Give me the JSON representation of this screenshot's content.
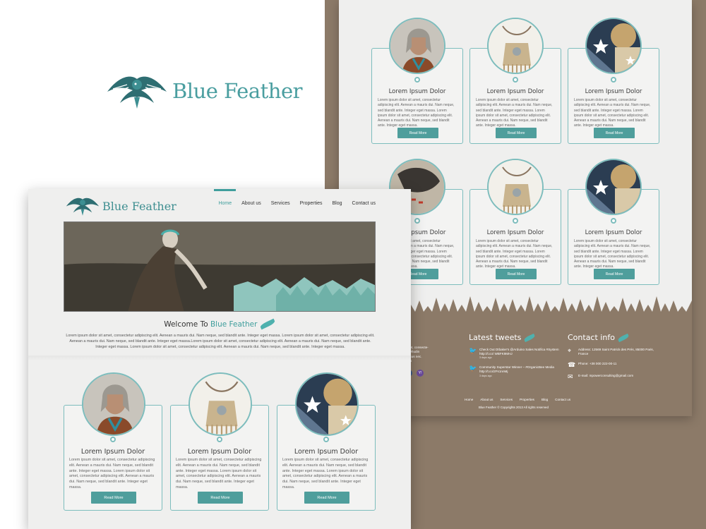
{
  "brand": {
    "name": "Blue Feather",
    "accent_color": "#4a9ea0",
    "footer_color": "#8c7a68"
  },
  "nav": {
    "items": [
      "Home",
      "About us",
      "Services",
      "Properties",
      "Blog",
      "Contact us"
    ],
    "active": "Home"
  },
  "welcome": {
    "prefix": "Welcome To",
    "brand": "Blue Feather",
    "text": "Lorem ipsum dolor sit amet, consectetur adipiscing elit. Aenean a mauris dui. Nam neque, sed blandit ante. Integer eget massa. Lorem ipsum dolor sit amet, consectetur adipiscing elit. Aenean a mauris dui. Nam neque, sed blandit ante. Integer eget massa.Lorem ipsum dolor sit amet, consectetur adipiscing elit. Aenean a mauris dui. Nam neque, sed blandit ante. Integer eget massa. Lorem ipsum dolor sit amet, consectetur adipiscing elit. Aenean a mauris dui. Nam neque, sed blandit ante. Integer eget massa."
  },
  "cards": [
    {
      "title": "Lorem Ipsum Dolor",
      "image": "portrait-photo",
      "text": "Lorem ipsum dolor sit amet, consectetur adipiscing elit. Aenean a mauris dui. Nam neque, sed blandit ante. Integer eget massa. Lorem ipsum dolor sit amet, consectetur adipiscing elit. Aenean a mauris dui. Nam neque, sed blandit ante. Integer eget massa.",
      "button": "Read More"
    },
    {
      "title": "Lorem Ipsum Dolor",
      "image": "medicine-bag-photo",
      "text": "Lorem ipsum dolor sit amet, consectetur adipiscing elit. Aenean a mauris dui. Nam neque, sed blandit ante. Integer eget massa. Lorem ipsum dolor sit amet, consectetur adipiscing elit. Aenean a mauris dui. Nam neque, sed blandit ante. Integer eget massa.",
      "button": "Read More"
    },
    {
      "title": "Lorem Ipsum Dolor",
      "image": "star-art-photo",
      "text": "Lorem ipsum dolor sit amet, consectetur adipiscing elit. Aenean a mauris dui. Nam neque, sed blandit ante. Integer eget massa. Lorem ipsum dolor sit amet, consectetur adipiscing elit. Aenean a mauris dui. Nam neque, sed blandit ante. Integer eget massa.",
      "button": "Read More"
    }
  ],
  "back_cards_row2": [
    {
      "title": "Lorem Ipsum Dolor",
      "image": "dreamcatcher-photo",
      "button": "Read More"
    },
    {
      "title": "Lorem Ipsum Dolor",
      "image": "medicine-bag-photo",
      "button": "Read More"
    },
    {
      "title": "Lorem Ipsum Dolor",
      "image": "star-art-photo",
      "button": "Read More"
    }
  ],
  "footer": {
    "about_snippet": [
      "amet, consecte-",
      "willehudin",
      "curcus nec.",
      "arcu"
    ],
    "tweets_title": "Latest tweets",
    "tweets": [
      {
        "text": "Check Out Dtbaker's @Arduino Sales Notifica #System http://t.co/ WBFK9MHJ",
        "time": "3 days ago"
      },
      {
        "text": "Community Superstar Winner – #OrganicBee Media http://t.co/2Fs1nnMj",
        "time": "3 days ago"
      }
    ],
    "contact_title": "Contact info",
    "address": "Address: 12569 Saint Patrick des Prés, 85000 Paris, France",
    "phone": "Phone: +38 000 222-00-11",
    "email": "E-mail: mpowerconsulting@gmail.com",
    "nav": [
      "Home",
      "About us",
      "Services",
      "Properties",
      "Blog",
      "Contact us"
    ],
    "copyright": "Blue Feather © Copyrights 2013 All rights reserved"
  }
}
